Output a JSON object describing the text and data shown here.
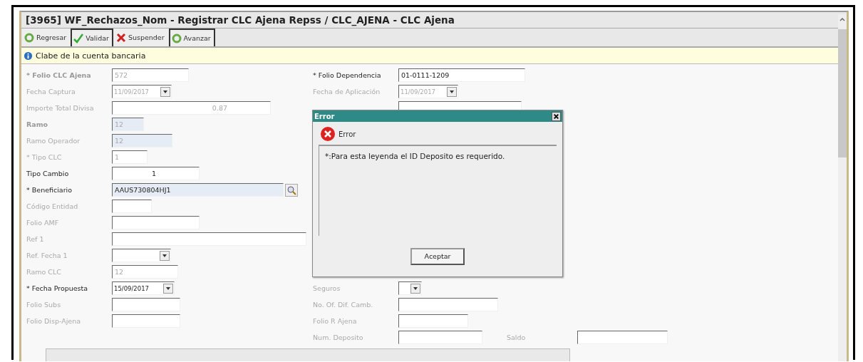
{
  "window": {
    "title": "[3965]  WF_Rechazos_Nom - Registrar CLC Ajena Repss / CLC_AJENA - CLC Ajena"
  },
  "toolbar": [
    {
      "label": "Regresar",
      "kind": "navigate",
      "outlined": false
    },
    {
      "label": "Validar",
      "kind": "validate",
      "outlined": true
    },
    {
      "label": "Suspender",
      "kind": "suspend",
      "outlined": false
    },
    {
      "label": "Avanzar",
      "kind": "navigate",
      "outlined": true
    }
  ],
  "info_bar": {
    "text": "Clabe de la cuenta bancaria"
  },
  "form": {
    "left": [
      {
        "label": "* Folio CLC Ajena",
        "kind": "text",
        "value": "572",
        "disabled": true,
        "bold": true,
        "highlighted": false,
        "numeric": false
      },
      {
        "label": "Fecha Captura",
        "kind": "date",
        "value": "11/09/2017",
        "disabled": true,
        "bold": false,
        "highlighted": false,
        "numeric": false
      },
      {
        "label": "Importe Total Divisa",
        "kind": "text",
        "value": "0.87",
        "disabled": true,
        "bold": false,
        "highlighted": false,
        "numeric": true
      },
      {
        "label": "Ramo",
        "kind": "text",
        "value": "12",
        "disabled": true,
        "bold": true,
        "highlighted": true,
        "numeric": false
      },
      {
        "label": "Ramo Operador",
        "kind": "text",
        "value": "12",
        "disabled": true,
        "bold": false,
        "highlighted": true,
        "numeric": false
      },
      {
        "label": "* Tipo CLC",
        "kind": "text",
        "value": "1",
        "disabled": true,
        "bold": false,
        "highlighted": false,
        "numeric": false
      },
      {
        "label": "Tipo Cambio",
        "kind": "text",
        "value": "1",
        "disabled": false,
        "bold": false,
        "highlighted": false,
        "numeric": true
      },
      {
        "label": "* Beneficiario",
        "kind": "search",
        "value": "AAUS730804HJ1",
        "disabled": false,
        "bold": false,
        "highlighted": true,
        "numeric": false
      },
      {
        "label": "Código Entidad",
        "kind": "text",
        "disabled": true,
        "bold": false,
        "highlighted": false,
        "numeric": false
      },
      {
        "label": "Folio AMF",
        "kind": "text",
        "disabled": true,
        "bold": false,
        "highlighted": false,
        "numeric": false
      },
      {
        "label": "Ref 1",
        "kind": "text",
        "disabled": true,
        "bold": false,
        "highlighted": false,
        "numeric": false
      },
      {
        "label": "Ref. Fecha 1",
        "kind": "date",
        "disabled": true,
        "bold": false,
        "highlighted": false,
        "numeric": false
      },
      {
        "label": "Ramo CLC",
        "kind": "text",
        "value": "12",
        "disabled": true,
        "bold": false,
        "highlighted": false,
        "numeric": false
      },
      {
        "label": "* Fecha Propuesta",
        "kind": "date",
        "value": "15/09/2017",
        "disabled": false,
        "bold": false,
        "highlighted": false,
        "numeric": false
      },
      {
        "label": "Folio Subs",
        "kind": "text",
        "disabled": true,
        "bold": false,
        "highlighted": false,
        "numeric": false
      },
      {
        "label": "Folio Disp-Ajena",
        "kind": "text",
        "disabled": true,
        "bold": false,
        "highlighted": false,
        "numeric": false
      }
    ],
    "right": [
      {
        "label": "* Folio Dependencia",
        "kind": "text",
        "value": "01-0111-1209",
        "disabled": false,
        "bold": false,
        "highlighted": false,
        "numeric": false
      },
      {
        "label": "Fecha de Aplicación",
        "kind": "date",
        "value": "11/09/2017",
        "disabled": true,
        "bold": false,
        "highlighted": false,
        "numeric": false
      },
      {
        "kind": "text"
      },
      {
        "label": "Seguros",
        "kind": "date",
        "disabled": true,
        "bold": false,
        "highlighted": false,
        "numeric": false
      },
      {
        "label": "No. Of. Dif. Camb.",
        "kind": "text",
        "disabled": true,
        "bold": false,
        "highlighted": false,
        "numeric": false
      },
      {
        "label": "Folio R Ajena",
        "kind": "text",
        "disabled": true,
        "bold": false,
        "highlighted": false,
        "numeric": false
      },
      {
        "label": "Num. Deposito",
        "kind": "text",
        "disabled": true,
        "bold": false,
        "highlighted": false,
        "numeric": false,
        "extra": {
          "label": "Saldo"
        }
      }
    ]
  },
  "dialog": {
    "title": "Error",
    "heading": "Error",
    "message": "*:Para esta leyenda el ID Deposito es requerido.",
    "button": "Aceptar"
  }
}
